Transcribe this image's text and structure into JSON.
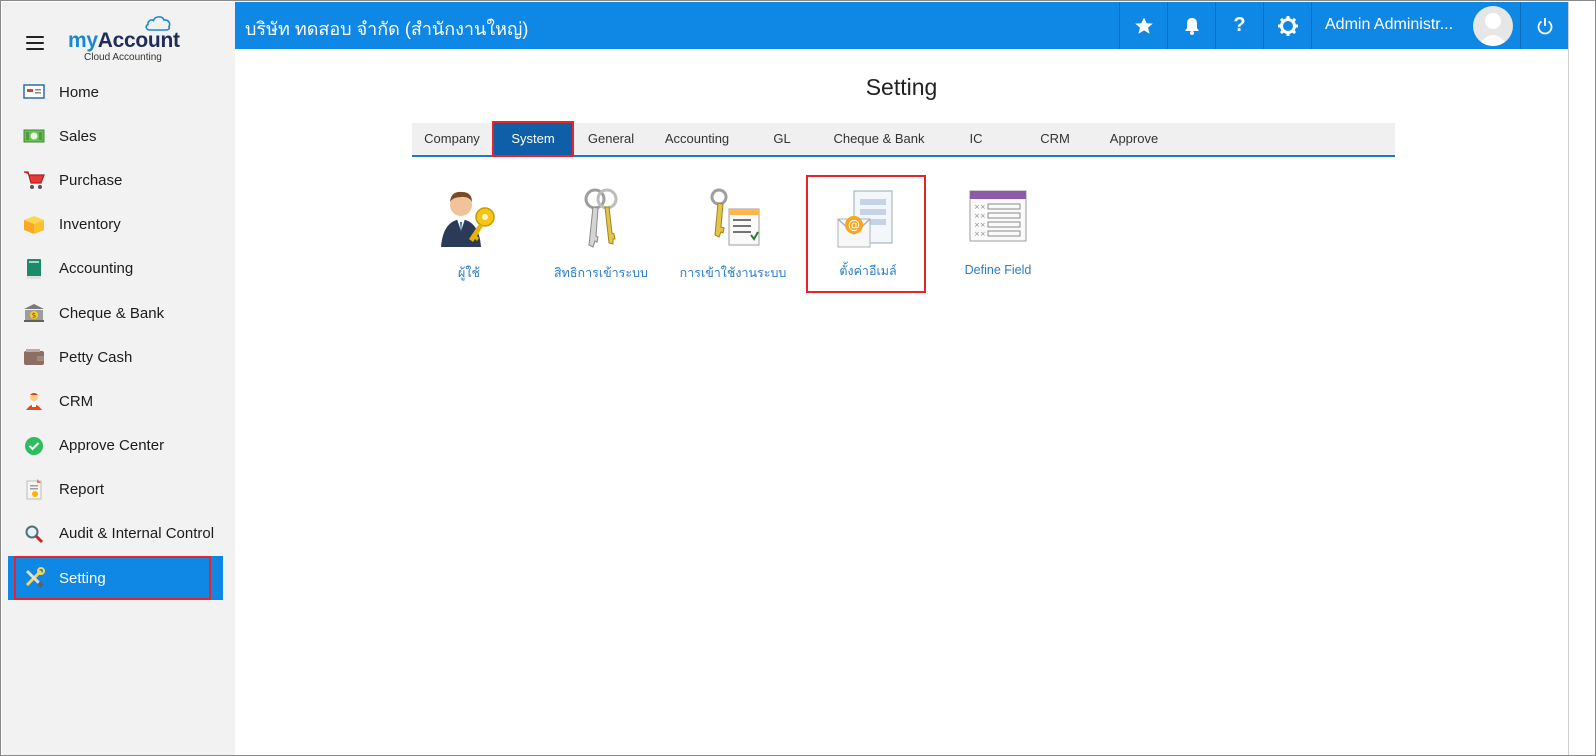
{
  "brand": {
    "logo_my": "my",
    "logo_account": "Account",
    "logo_sub": "Cloud Accounting"
  },
  "sidebar": {
    "items": [
      {
        "label": "Home",
        "icon": "home-icon"
      },
      {
        "label": "Sales",
        "icon": "money-icon"
      },
      {
        "label": "Purchase",
        "icon": "cart-icon"
      },
      {
        "label": "Inventory",
        "icon": "box-icon"
      },
      {
        "label": "Accounting",
        "icon": "ledger-icon"
      },
      {
        "label": "Cheque & Bank",
        "icon": "bank-icon"
      },
      {
        "label": "Petty Cash",
        "icon": "wallet-icon"
      },
      {
        "label": "CRM",
        "icon": "people-icon"
      },
      {
        "label": "Approve Center",
        "icon": "check-circle-icon"
      },
      {
        "label": "Report",
        "icon": "report-icon"
      },
      {
        "label": "Audit & Internal Control",
        "icon": "magnifier-icon"
      },
      {
        "label": "Setting",
        "icon": "tools-icon",
        "active": true
      }
    ]
  },
  "header": {
    "company": "บริษัท ทดสอบ จำกัด (สำนักงานใหญ่)",
    "user_name": "Admin Administr...",
    "help_symbol": "?"
  },
  "main": {
    "title": "Setting",
    "tabs": [
      {
        "label": "Company"
      },
      {
        "label": "System",
        "active": true
      },
      {
        "label": "General"
      },
      {
        "label": "Accounting"
      },
      {
        "label": "GL"
      },
      {
        "label": "Cheque & Bank"
      },
      {
        "label": "IC"
      },
      {
        "label": "CRM"
      },
      {
        "label": "Approve"
      }
    ],
    "tiles": [
      {
        "label": "ผู้ใช้",
        "icon": "user-key-icon"
      },
      {
        "label": "สิทธิการเข้าระบบ",
        "icon": "keys-icon"
      },
      {
        "label": "การเข้าใช้งานระบบ",
        "icon": "keys-checklist-icon"
      },
      {
        "label": "ตั้งค่าอีเมล์",
        "icon": "email-settings-icon",
        "highlight": true
      },
      {
        "label": "Define Field",
        "icon": "field-list-icon"
      }
    ]
  },
  "colors": {
    "primary": "#0f87e4",
    "highlight": "#e8232a",
    "tab_active": "#0e5ea8",
    "tile_label": "#2a7cc7"
  }
}
